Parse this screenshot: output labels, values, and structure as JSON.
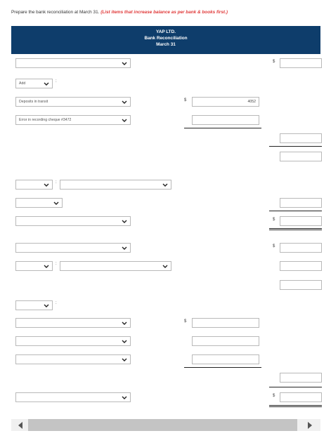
{
  "instruction": {
    "text": "Prepare the bank reconciliation at March 31.",
    "emphasis": "(List items that increase balance as per bank & books first.)"
  },
  "header": {
    "company": "YAP LTD.",
    "title": "Bank Reconciliation",
    "date": "March 31"
  },
  "currency_symbol": "$",
  "add_dropdown": {
    "value": "Add"
  },
  "rows": {
    "deposits_label": "Deposits in transit",
    "deposits_value": "4052",
    "error_label": "Error in recording cheque #3472"
  },
  "colon": ":"
}
